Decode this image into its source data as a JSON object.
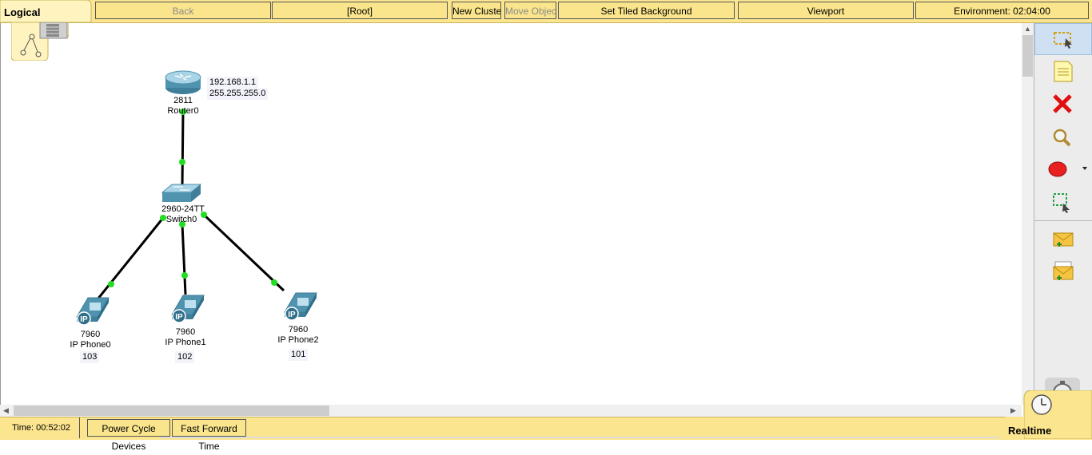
{
  "top_bar": {
    "tab_label": "Logical",
    "buttons": {
      "back": "Back",
      "root": "[Root]",
      "new_cluster": "New Cluster",
      "move_object": "Move Object",
      "set_tiled_background": "Set Tiled Background",
      "viewport": "Viewport",
      "environment": "Environment: 02:04:00"
    }
  },
  "devices": {
    "router": {
      "model": "2811",
      "name": "Router0",
      "ip": "192.168.1.1",
      "mask": "255.255.255.0"
    },
    "switch": {
      "model": "2960-24TT",
      "name": "Switch0"
    },
    "phones": [
      {
        "model": "7960",
        "name": "IP Phone0",
        "number": "103"
      },
      {
        "model": "7960",
        "name": "IP Phone1",
        "number": "102"
      },
      {
        "model": "7960",
        "name": "IP Phone2",
        "number": "101"
      }
    ]
  },
  "right_toolbar": {
    "tools": [
      "select-icon",
      "note-icon",
      "delete-icon",
      "inspect-icon",
      "draw-shape-icon",
      "resize-icon",
      "add-simple-pdu-icon",
      "add-complex-pdu-icon"
    ]
  },
  "bottom_bar": {
    "time": "Time: 00:52:02",
    "power_cycle": "Power Cycle Devices",
    "fast_forward": "Fast Forward Time",
    "mode_label": "Realtime"
  },
  "colors": {
    "bar": "#fbe58f",
    "link_light": "#22dd22",
    "cable": "#000000"
  }
}
